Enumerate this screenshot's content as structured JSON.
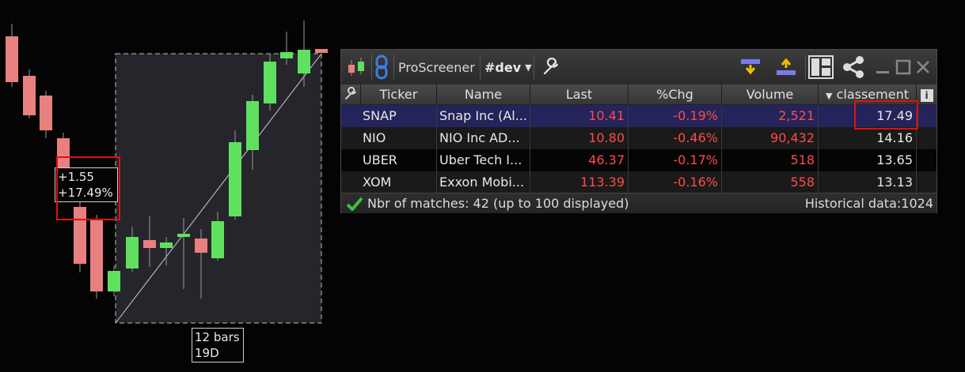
{
  "chart_overlay": {
    "measure": {
      "points": "+1.55",
      "percent": "+17.49%"
    },
    "duration": {
      "bars": "12 bars",
      "period": "19D"
    }
  },
  "screener": {
    "title": "ProScreener",
    "list": "#dev",
    "columns": [
      "Ticker",
      "Name",
      "Last",
      "%Chg",
      "Volume",
      "classement"
    ],
    "rows": [
      {
        "ticker": "SNAP",
        "name": "Snap Inc (Al...",
        "last": "10.41",
        "chg": "-0.19%",
        "volume": "2,521",
        "classement": "17.49"
      },
      {
        "ticker": "NIO",
        "name": "NIO Inc AD...",
        "last": "10.80",
        "chg": "-0.46%",
        "volume": "90,432",
        "classement": "14.16"
      },
      {
        "ticker": "UBER",
        "name": "Uber Tech I...",
        "last": "46.37",
        "chg": "-0.17%",
        "volume": "518",
        "classement": "13.65"
      },
      {
        "ticker": "XOM",
        "name": "Exxon Mobi...",
        "last": "113.39",
        "chg": "-0.16%",
        "volume": "558",
        "classement": "13.13"
      }
    ],
    "footer": {
      "matches": "Nbr of matches: 42 (up to 100 displayed)",
      "historical": "Historical data:1024"
    },
    "colors": {
      "negative": "#ff4a4a",
      "selected_row": "#24245a",
      "bull_candle": "#5fe05f",
      "bear_candle": "#f08080"
    }
  }
}
